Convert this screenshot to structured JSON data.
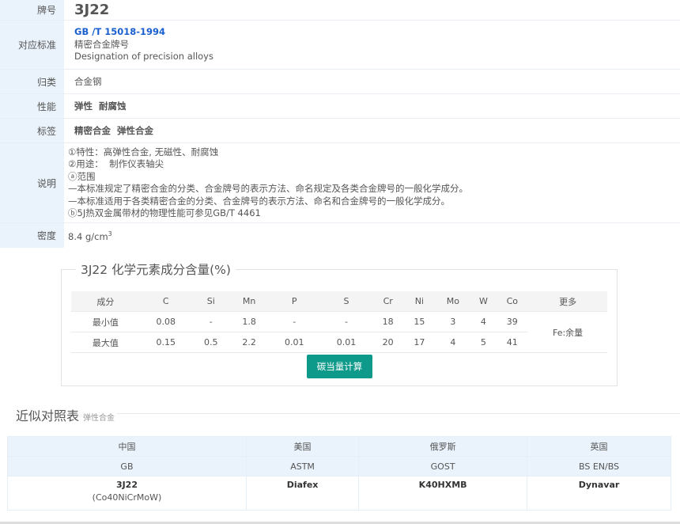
{
  "rows": {
    "grade": {
      "label": "牌号",
      "value": "3J22"
    },
    "standard": {
      "label": "对应标准",
      "code": "GB /T 15018-1994",
      "name_cn": "精密合金牌号",
      "name_en": "Designation of precision alloys"
    },
    "category": {
      "label": "归类",
      "value": "合金钢"
    },
    "performance": {
      "label": "性能",
      "value": "弹性  耐腐蚀"
    },
    "tags": {
      "label": "标签",
      "value": "精密合金  弹性合金"
    },
    "description": {
      "label": "说明",
      "lines": [
        "①特性：高弹性合金, 无磁性、耐腐蚀",
        "②用途：  制作仪表轴尖",
        "ⓐ范围",
        "—本标准规定了精密合金的分类、合金牌号的表示方法、命名规定及各类合金牌号的一般化学成分。",
        "—本标准适用于各类精密合金的分类、合金牌号的表示方法、命名和合金牌号的一般化学成分。",
        "ⓑ5J热双金属带材的物理性能可参见GB/T 4461"
      ]
    },
    "density": {
      "label": "密度",
      "value": "8.4 g/cm",
      "sup": "3"
    }
  },
  "chem": {
    "title": "3J22 化学元素成分含量(%)",
    "headers": [
      "成分",
      "C",
      "Si",
      "Mn",
      "P",
      "S",
      "Cr",
      "Ni",
      "Mo",
      "W",
      "Co",
      "更多"
    ],
    "min_row": [
      "最小值",
      "0.08",
      "-",
      "1.8",
      "-",
      "-",
      "18",
      "15",
      "3",
      "4",
      "39"
    ],
    "max_row": [
      "最大值",
      "0.15",
      "0.5",
      "2.2",
      "0.01",
      "0.01",
      "20",
      "17",
      "4",
      "5",
      "41"
    ],
    "more": "Fe:余量",
    "button": "碳当量计算"
  },
  "similar": {
    "title": "近似对照表",
    "subtitle": "弹性合金",
    "countries": [
      "中国",
      "美国",
      "俄罗斯",
      "英国"
    ],
    "standards": [
      "GB",
      "ASTM",
      "GOST",
      "BS EN/BS"
    ],
    "grades": [
      "3J22",
      "Diafex",
      "K40HXMB",
      "Dynavar"
    ],
    "grade_note": "(Co40NiCrMoW)"
  }
}
